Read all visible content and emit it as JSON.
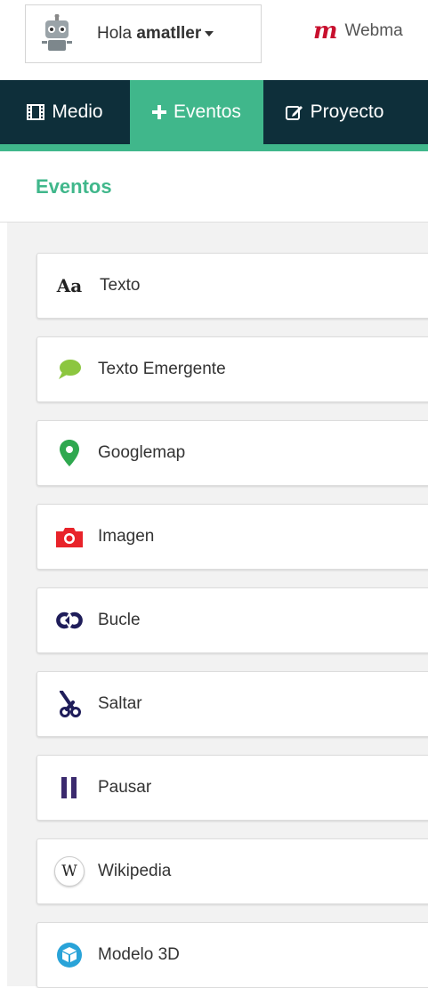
{
  "header": {
    "greeting": "Hola",
    "username": "amatller",
    "webmaker_logo": "m",
    "webmaker_label": "Webma"
  },
  "tabs": [
    {
      "label": "Medio",
      "icon": "film-icon",
      "active": false
    },
    {
      "label": "Eventos",
      "icon": "plus-icon",
      "active": true
    },
    {
      "label": "Proyecto",
      "icon": "edit-icon",
      "active": false
    }
  ],
  "panel": {
    "title": "Eventos",
    "events": [
      {
        "label": "Texto",
        "icon": "text-icon",
        "icon_text": "Aa"
      },
      {
        "label": "Texto Emergente",
        "icon": "speech-bubble-icon"
      },
      {
        "label": "Googlemap",
        "icon": "map-pin-icon"
      },
      {
        "label": "Imagen",
        "icon": "camera-icon"
      },
      {
        "label": "Bucle",
        "icon": "loop-icon"
      },
      {
        "label": "Saltar",
        "icon": "scissors-icon"
      },
      {
        "label": "Pausar",
        "icon": "pause-icon"
      },
      {
        "label": "Wikipedia",
        "icon": "wikipedia-icon",
        "icon_text": "W"
      },
      {
        "label": "Modelo 3D",
        "icon": "cube-icon"
      }
    ]
  },
  "colors": {
    "accent": "#40b78b",
    "tabbar": "#0e2f3a",
    "webmaker_red": "#c8102e",
    "bubble_green": "#8cc63f",
    "pin_green": "#2fa84f",
    "camera_red": "#e8232a",
    "purple": "#3b2a6e",
    "cube_blue": "#29a3d8"
  }
}
